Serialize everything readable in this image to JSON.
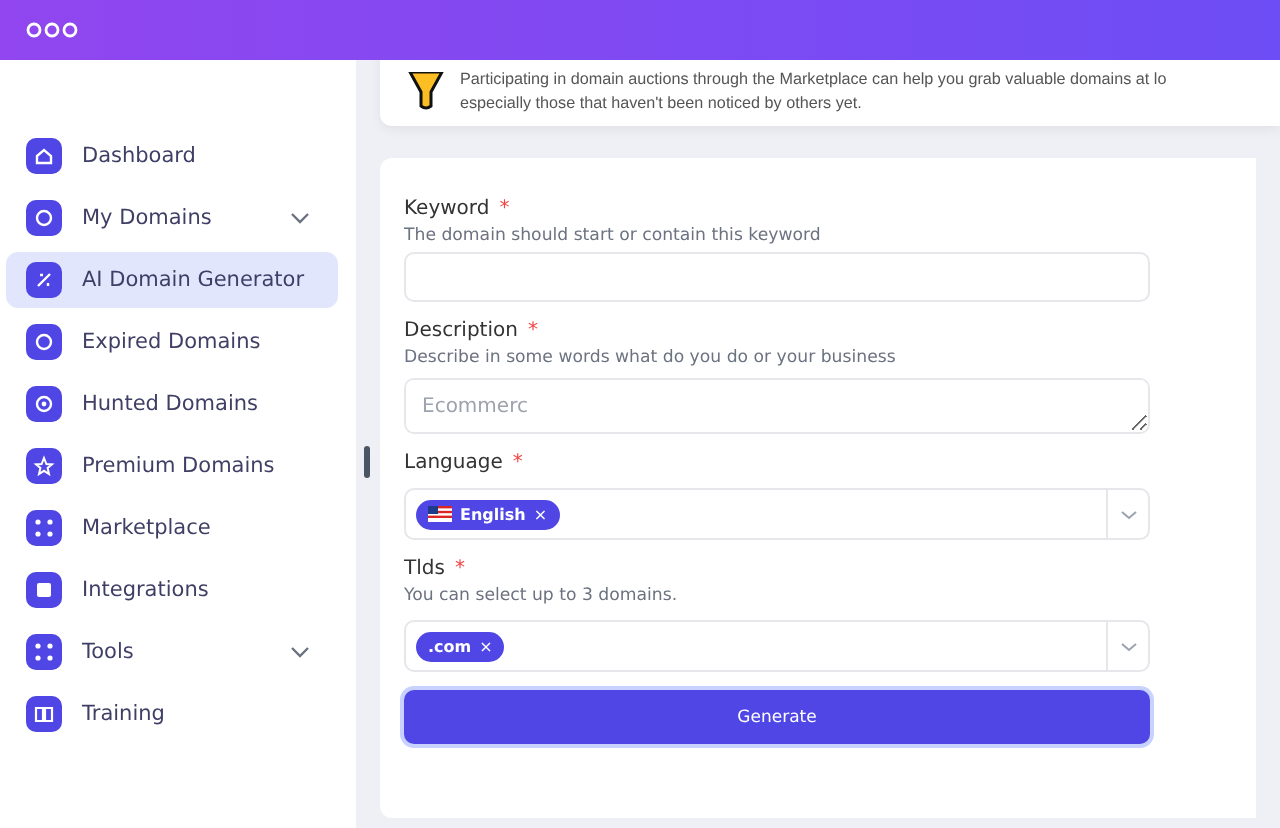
{
  "tip": {
    "lines": [
      "Participating in domain auctions through the Marketplace can help you grab valuable domains at lo",
      "especially those that haven't been noticed by others yet."
    ]
  },
  "sidebar": {
    "items": [
      {
        "label": "Dashboard",
        "selected": false,
        "expandable": false
      },
      {
        "label": "My Domains",
        "selected": false,
        "expandable": true
      },
      {
        "label": "AI Domain Generator",
        "selected": true,
        "expandable": false
      },
      {
        "label": "Expired Domains",
        "selected": false,
        "expandable": false
      },
      {
        "label": "Hunted Domains",
        "selected": false,
        "expandable": false
      },
      {
        "label": "Premium Domains",
        "selected": false,
        "expandable": false
      },
      {
        "label": "Marketplace",
        "selected": false,
        "expandable": false
      },
      {
        "label": "Integrations",
        "selected": false,
        "expandable": false
      },
      {
        "label": "Tools",
        "selected": false,
        "expandable": true
      },
      {
        "label": "Training",
        "selected": false,
        "expandable": false
      }
    ]
  },
  "form": {
    "fields": [
      {
        "kind": "text",
        "label": "Keyword",
        "required": "*",
        "hint": "The domain should start or contain this keyword"
      },
      {
        "kind": "textarea",
        "label": "Description",
        "required": "*",
        "hint": "Describe in some words what do you do or your business",
        "placeholder": "Ecommerc"
      },
      {
        "kind": "select",
        "label": "Language",
        "required": "*",
        "tags": [
          {
            "label": "English",
            "flag": true,
            "remove": "×"
          }
        ]
      },
      {
        "kind": "select",
        "label": "Tlds",
        "required": "*",
        "hint": "You can select up to 3 domains.",
        "tags": [
          {
            "label": ".com",
            "flag": false,
            "remove": "×"
          }
        ]
      }
    ],
    "submit": "Generate"
  }
}
